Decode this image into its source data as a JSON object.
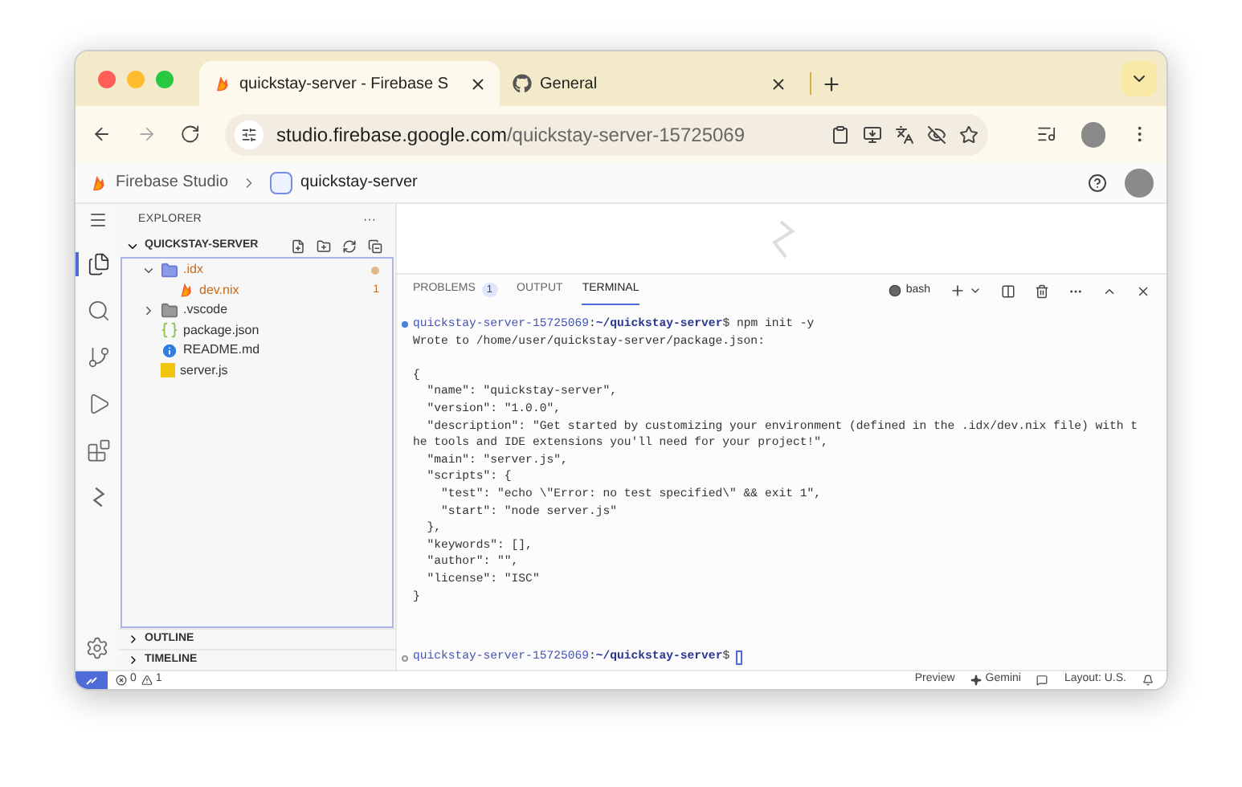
{
  "browser": {
    "tabs": [
      {
        "title": "quickstay-server - Firebase S",
        "kind": "firebase",
        "selected": true
      },
      {
        "title": "General",
        "kind": "github",
        "selected": false
      }
    ],
    "url": {
      "host": "studio.firebase.google.com",
      "path": "/quickstay-server-15725069"
    }
  },
  "app_header": {
    "brand": "Firebase Studio",
    "project": "quickstay-server"
  },
  "activity_bar": [
    {
      "kind": "files",
      "selected": true
    },
    {
      "kind": "search",
      "selected": false
    },
    {
      "kind": "source-control",
      "selected": false
    },
    {
      "kind": "run",
      "selected": false
    },
    {
      "kind": "extensions",
      "selected": false
    },
    {
      "kind": "firebase",
      "selected": false
    }
  ],
  "explorer": {
    "title": "EXPLORER",
    "more": "···",
    "root": {
      "label": "QUICKSTAY-SERVER",
      "expanded": true
    },
    "tree": [
      {
        "name": ".idx",
        "kind": "folder",
        "expanded": true,
        "warning": true,
        "modified": true,
        "children": [
          {
            "name": "dev.nix",
            "kind": "nix",
            "warning": true,
            "badge": "1"
          }
        ]
      },
      {
        "name": ".vscode",
        "kind": "folder",
        "expanded": false,
        "warning": false,
        "modified": false
      },
      {
        "name": "package.json",
        "kind": "json",
        "warning": false
      },
      {
        "name": "README.md",
        "kind": "info",
        "warning": false
      },
      {
        "name": "server.js",
        "kind": "js",
        "warning": false
      }
    ],
    "sections": [
      {
        "label": "OUTLINE",
        "expanded": false
      },
      {
        "label": "TIMELINE",
        "expanded": false
      }
    ]
  },
  "panel": {
    "tabs": [
      {
        "label": "PROBLEMS",
        "badge": "1",
        "selected": false
      },
      {
        "label": "OUTPUT",
        "selected": false
      },
      {
        "label": "TERMINAL",
        "selected": true
      }
    ],
    "shell": "bash",
    "lines": [
      {
        "kind": "prompt",
        "host": "quickstay-server-15725069",
        "separator": ":",
        "path": "~/quickstay-server",
        "prompt_char": "$",
        "command": "npm init -y"
      },
      {
        "kind": "output",
        "text": "Wrote to /home/user/quickstay-server/package.json:"
      },
      {
        "kind": "blank"
      },
      {
        "kind": "output",
        "text": "{"
      },
      {
        "kind": "output",
        "text": "  \"name\": \"quickstay-server\","
      },
      {
        "kind": "output",
        "text": "  \"version\": \"1.0.0\","
      },
      {
        "kind": "output",
        "text": "  \"description\": \"Get started by customizing your environment (defined in the .idx/dev.nix file) with t"
      },
      {
        "kind": "output",
        "text": "he tools and IDE extensions you'll need for your project!\","
      },
      {
        "kind": "output",
        "text": "  \"main\": \"server.js\","
      },
      {
        "kind": "output",
        "text": "  \"scripts\": {"
      },
      {
        "kind": "output",
        "text": "    \"test\": \"echo \\\"Error: no test specified\\\" && exit 1\","
      },
      {
        "kind": "output",
        "text": "    \"start\": \"node server.js\""
      },
      {
        "kind": "output",
        "text": "  },"
      },
      {
        "kind": "output",
        "text": "  \"keywords\": [],"
      },
      {
        "kind": "output",
        "text": "  \"author\": \"\","
      },
      {
        "kind": "output",
        "text": "  \"license\": \"ISC\""
      },
      {
        "kind": "output",
        "text": "}"
      }
    ],
    "current_prompt": {
      "host": "quickstay-server-15725069",
      "separator": ":",
      "path": "~/quickstay-server",
      "prompt_char": "$"
    }
  },
  "status_bar": {
    "errors": "0",
    "warnings": "1",
    "items": [
      "Preview",
      "Gemini",
      "Layout: U.S."
    ]
  }
}
